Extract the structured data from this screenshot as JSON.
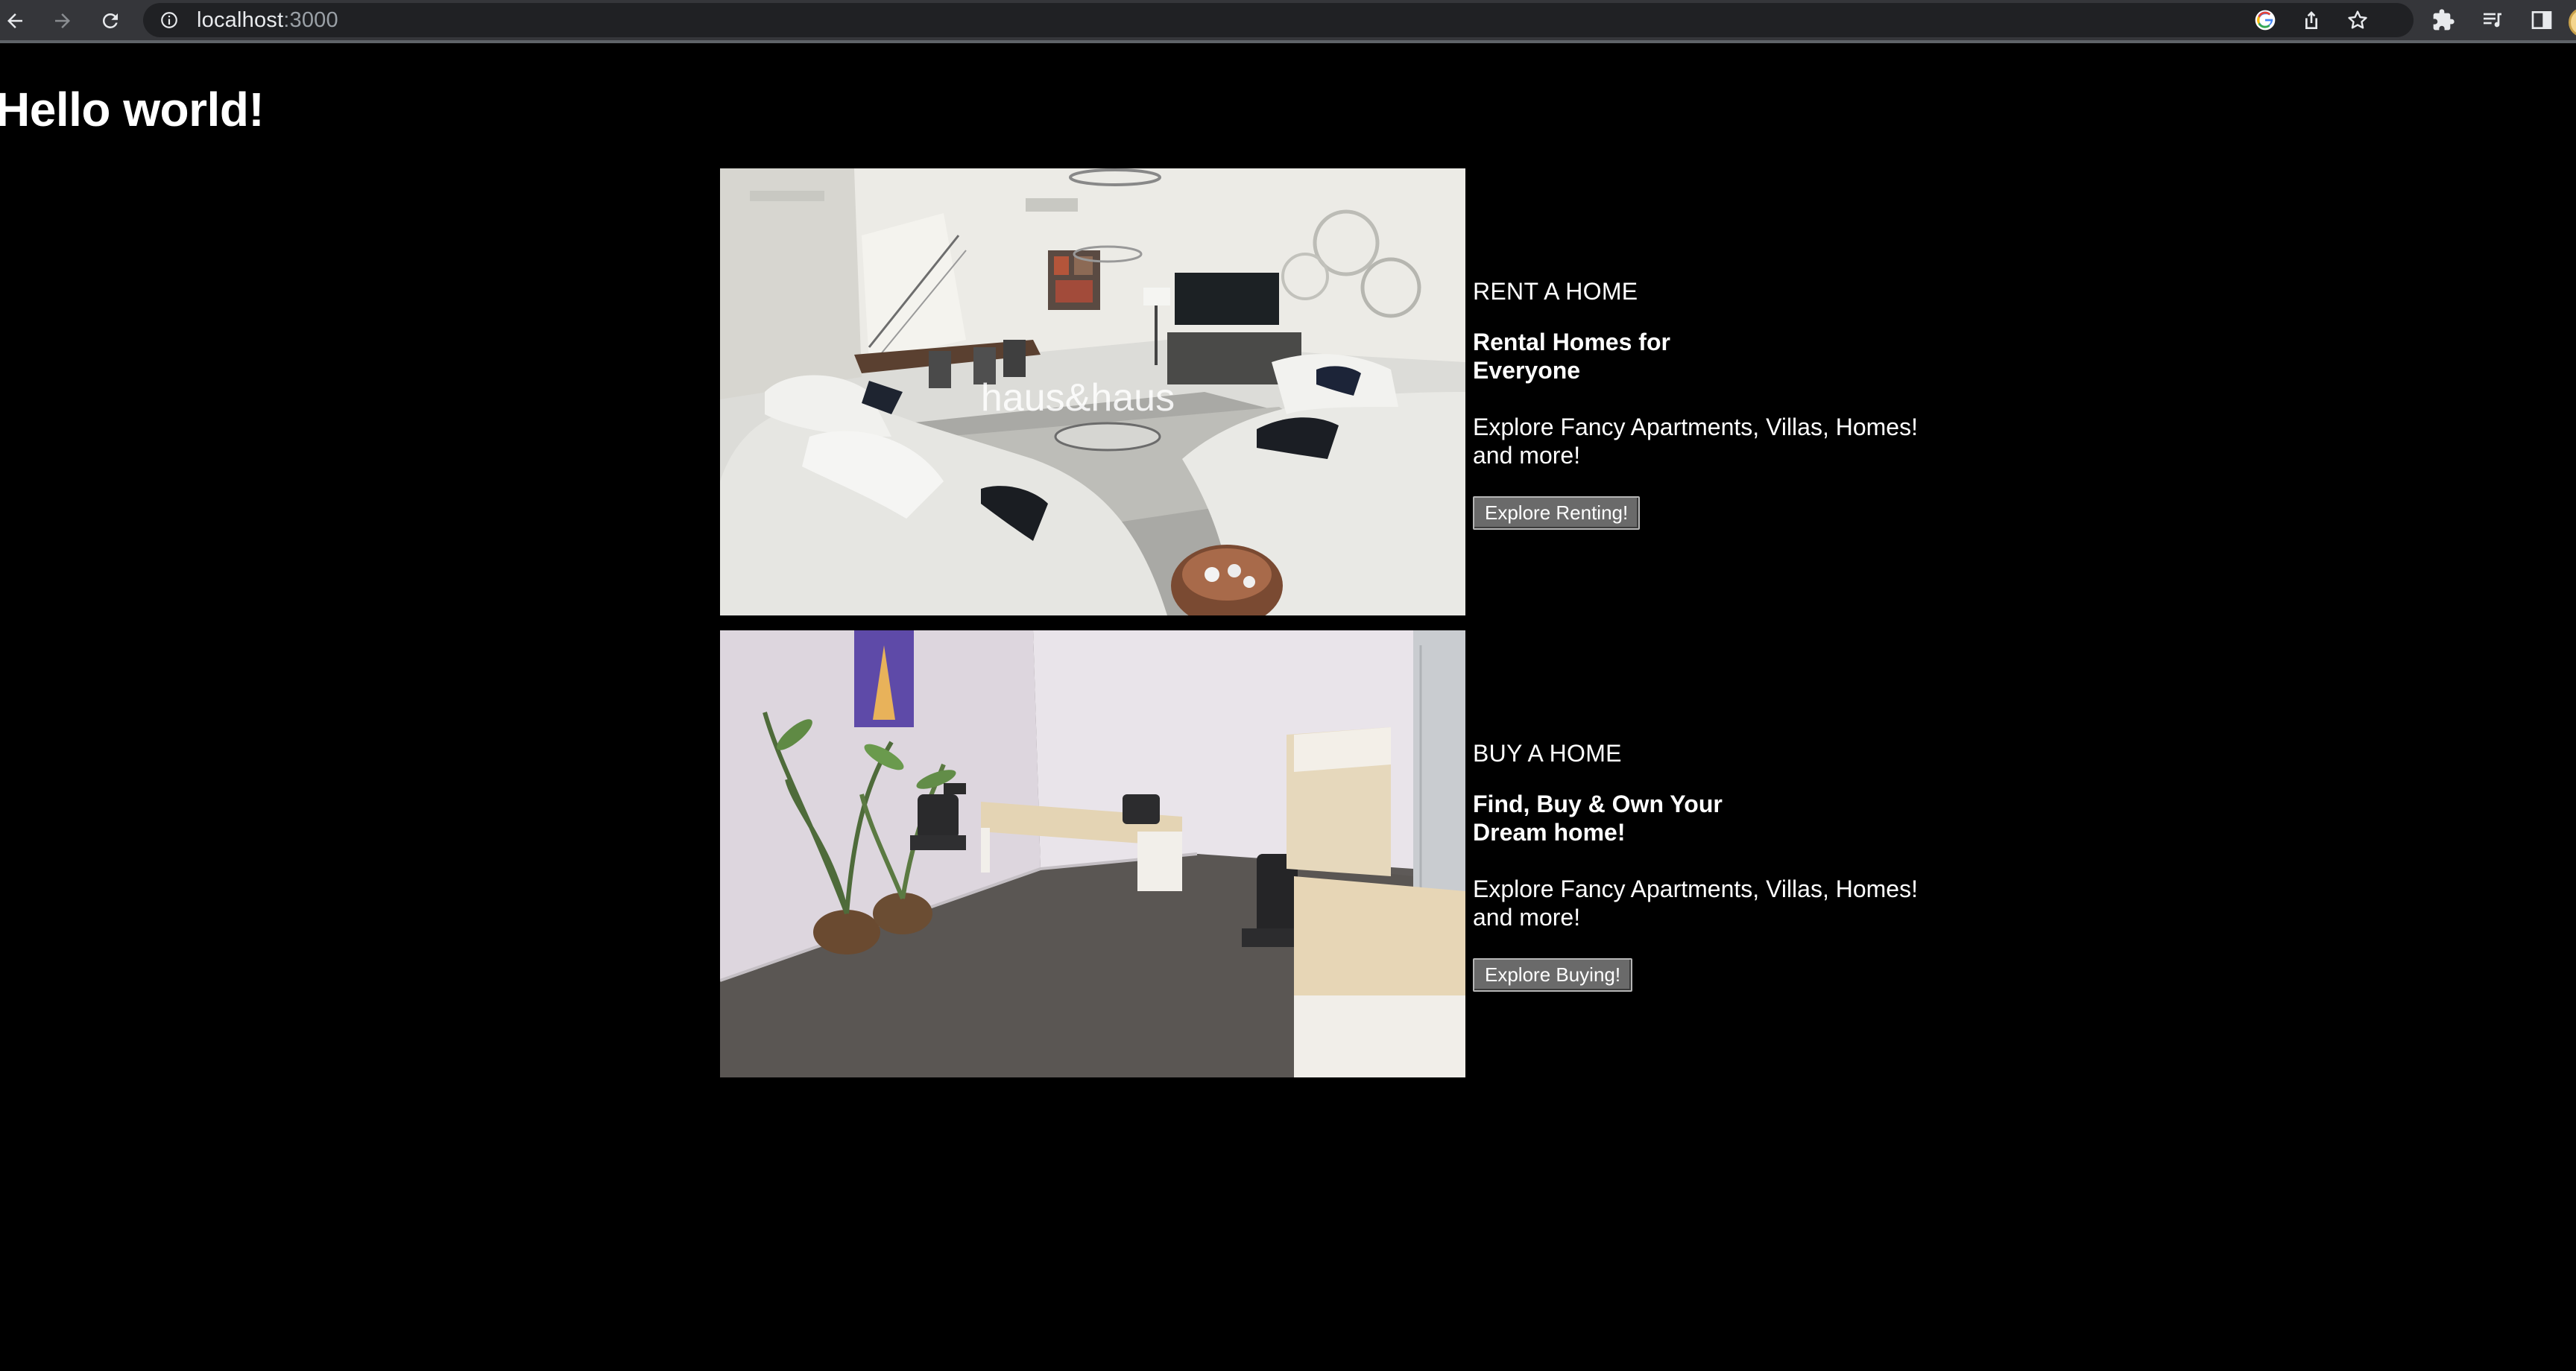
{
  "browser": {
    "url_host": "localhost",
    "url_port": ":3000",
    "icons": {
      "back": "arrow-left-icon",
      "forward": "arrow-right-icon",
      "reload": "reload-icon",
      "site_info": "info-icon",
      "google": "google-icon",
      "share": "share-icon",
      "bookmark": "star-icon",
      "extensions": "puzzle-icon",
      "media": "media-queue-icon",
      "side_panel": "side-panel-icon",
      "profile": "avatar"
    }
  },
  "page": {
    "title": "Hello world!",
    "background": "#000000"
  },
  "sections": [
    {
      "kicker": "RENT A HOME",
      "headline": "Rental Homes for Everyone",
      "description": "Explore Fancy Apartments, Villas, Homes! and more!",
      "button_label": "Explore Renting!",
      "image_watermark": "haus&haus"
    },
    {
      "kicker": "BUY A HOME",
      "headline": "Find, Buy & Own Your Dream home!",
      "description": "Explore Fancy Apartments, Villas, Homes! and more!",
      "button_label": "Explore Buying!"
    }
  ]
}
